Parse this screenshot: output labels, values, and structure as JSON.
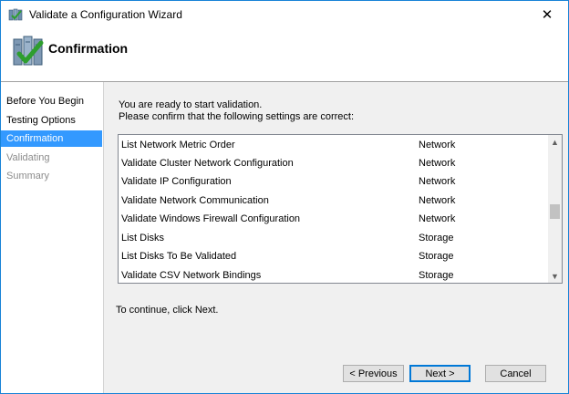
{
  "window": {
    "title": "Validate a Configuration Wizard",
    "close_glyph": "✕"
  },
  "header": {
    "title": "Confirmation",
    "icon": "cluster-validate-check-icon"
  },
  "nav": {
    "items": [
      {
        "label": "Before You Begin",
        "state": "normal"
      },
      {
        "label": "Testing Options",
        "state": "normal"
      },
      {
        "label": "Confirmation",
        "state": "active"
      },
      {
        "label": "Validating",
        "state": "disabled"
      },
      {
        "label": "Summary",
        "state": "disabled"
      }
    ]
  },
  "main": {
    "intro_line1": "You are ready to start validation.",
    "intro_line2": "Please confirm that the following settings are correct:",
    "rows": [
      {
        "name": "List Network Metric Order",
        "category": "Network"
      },
      {
        "name": "Validate Cluster Network Configuration",
        "category": "Network"
      },
      {
        "name": "Validate IP Configuration",
        "category": "Network"
      },
      {
        "name": "Validate Network Communication",
        "category": "Network"
      },
      {
        "name": "Validate Windows Firewall Configuration",
        "category": "Network"
      },
      {
        "name": "List Disks",
        "category": "Storage"
      },
      {
        "name": "List Disks To Be Validated",
        "category": "Storage"
      },
      {
        "name": "Validate CSV Network Bindings",
        "category": "Storage"
      }
    ],
    "continue_text": "To continue, click Next."
  },
  "buttons": {
    "previous": "< Previous",
    "next": "Next >",
    "cancel": "Cancel"
  },
  "colors": {
    "accent": "#3399ff",
    "window_border": "#1883d7",
    "check_green": "#2e9e2e"
  }
}
